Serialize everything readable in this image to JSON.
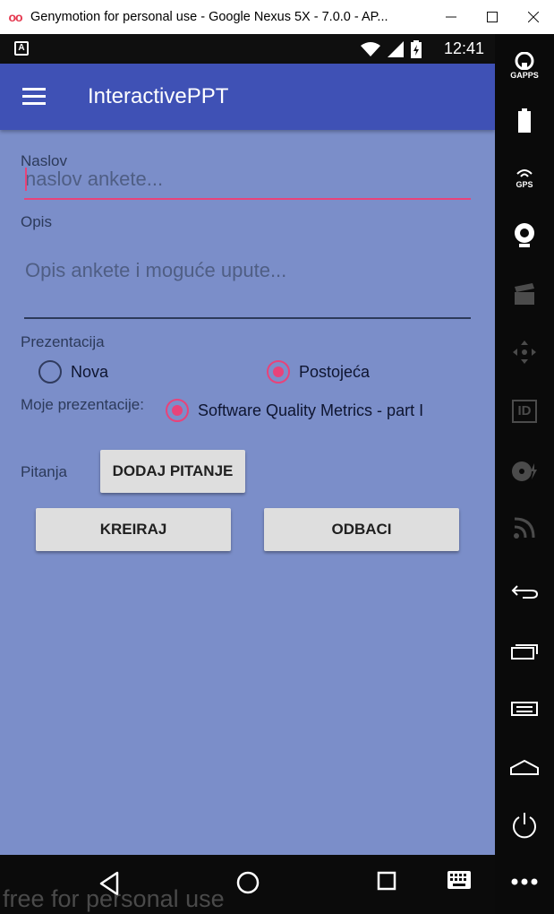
{
  "window": {
    "title": "Genymotion for personal use - Google Nexus 5X - 7.0.0 - AP...",
    "logo": "oo"
  },
  "statusbar": {
    "time": "12:41",
    "notif": "A"
  },
  "appbar": {
    "title": "InteractivePPT"
  },
  "form": {
    "naslov_label": "Naslov",
    "naslov_placeholder": "naslov ankete...",
    "opis_label": "Opis",
    "opis_placeholder": "Opis ankete i moguće upute...",
    "prezentacija_label": "Prezentacija",
    "option_nova": "Nova",
    "option_postojeca": "Postojeća",
    "selected_option": "Postojeća",
    "moje_prezentacije_label": "Moje prezentacije:",
    "my_presentation": "Software Quality Metrics - part I",
    "pitanja_label": "Pitanja",
    "add_question_button": "DODAJ PITANJE",
    "create_button": "KREIRAJ",
    "discard_button": "ODBACI"
  },
  "sidepanel": {
    "gapps": "GAPPS",
    "gps": "GPS",
    "id": "ID"
  },
  "watermark": "free for personal use",
  "colors": {
    "primary": "#3f51b5",
    "accent": "#e8437a",
    "background": "#7b8ec9"
  }
}
